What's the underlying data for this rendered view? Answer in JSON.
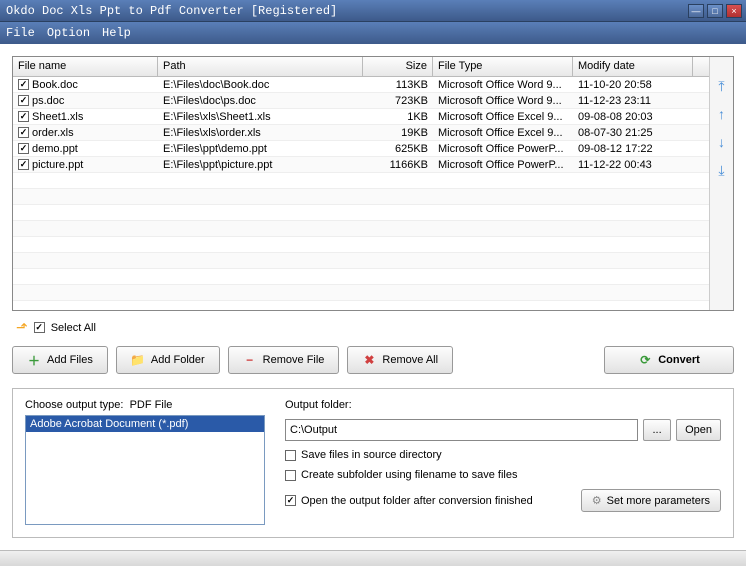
{
  "title": "Okdo Doc Xls Ppt to Pdf Converter [Registered]",
  "menu": {
    "file": "File",
    "option": "Option",
    "help": "Help"
  },
  "columns": {
    "name": "File name",
    "path": "Path",
    "size": "Size",
    "type": "File Type",
    "date": "Modify date"
  },
  "files": [
    {
      "name": "Book.doc",
      "path": "E:\\Files\\doc\\Book.doc",
      "size": "113KB",
      "type": "Microsoft Office Word 9...",
      "date": "11-10-20 20:58",
      "checked": true
    },
    {
      "name": "ps.doc",
      "path": "E:\\Files\\doc\\ps.doc",
      "size": "723KB",
      "type": "Microsoft Office Word 9...",
      "date": "11-12-23 23:11",
      "checked": true
    },
    {
      "name": "Sheet1.xls",
      "path": "E:\\Files\\xls\\Sheet1.xls",
      "size": "1KB",
      "type": "Microsoft Office Excel 9...",
      "date": "09-08-08 20:03",
      "checked": true
    },
    {
      "name": "order.xls",
      "path": "E:\\Files\\xls\\order.xls",
      "size": "19KB",
      "type": "Microsoft Office Excel 9...",
      "date": "08-07-30 21:25",
      "checked": true
    },
    {
      "name": "demo.ppt",
      "path": "E:\\Files\\ppt\\demo.ppt",
      "size": "625KB",
      "type": "Microsoft Office PowerP...",
      "date": "09-08-12 17:22",
      "checked": true
    },
    {
      "name": "picture.ppt",
      "path": "E:\\Files\\ppt\\picture.ppt",
      "size": "1166KB",
      "type": "Microsoft Office PowerP...",
      "date": "11-12-22 00:43",
      "checked": true
    }
  ],
  "selectAll": "Select All",
  "buttons": {
    "addFiles": "Add Files",
    "addFolder": "Add Folder",
    "removeFile": "Remove File",
    "removeAll": "Remove All",
    "convert": "Convert"
  },
  "outputType": {
    "label": "Choose output type:",
    "current": "PDF File",
    "option": "Adobe Acrobat Document (*.pdf)"
  },
  "outputFolder": {
    "label": "Output folder:",
    "value": "C:\\Output",
    "browse": "...",
    "open": "Open"
  },
  "checks": {
    "saveSource": {
      "label": "Save files in source directory",
      "checked": false
    },
    "subfolder": {
      "label": "Create subfolder using filename to save files",
      "checked": false
    },
    "openAfter": {
      "label": "Open the output folder after conversion finished",
      "checked": true
    }
  },
  "params": "Set more parameters"
}
